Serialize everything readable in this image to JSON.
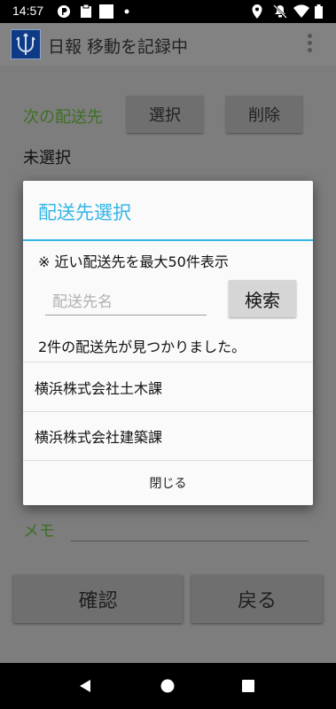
{
  "status_bar": {
    "time": "14:57"
  },
  "app_bar": {
    "title": "日報 移動を記録中"
  },
  "form": {
    "destination_label": "次の配送先",
    "select_button": "選択",
    "delete_button": "削除",
    "selected_value": "未選択",
    "memo_label": "メモ",
    "confirm_button": "確認",
    "back_button": "戻る"
  },
  "dialog": {
    "title": "配送先選択",
    "note": "※ 近い配送先を最大50件表示",
    "search_placeholder": "配送先名",
    "search_button": "検索",
    "result_message": "2件の配送先が見つかりました。",
    "results": [
      "横浜株式会社土木課",
      "横浜株式会社建築課"
    ],
    "close_button": "閉じる"
  },
  "colors": {
    "accent": "#33b5e5",
    "label_green": "#3e6f26",
    "dim_overlay": "#7d7d7d"
  }
}
